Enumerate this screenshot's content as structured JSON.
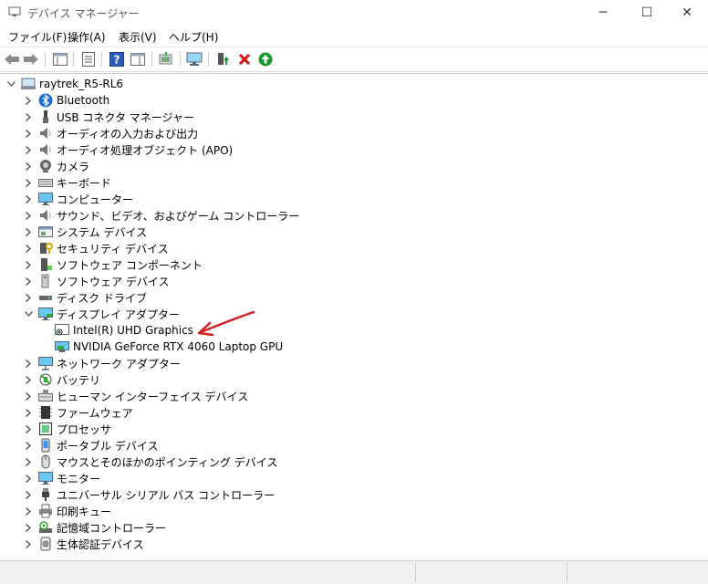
{
  "window": {
    "title": "デバイス マネージャー",
    "minimize_glyph": "─",
    "maximize_glyph": "☐",
    "close_glyph": "✕"
  },
  "menu": [
    "ファイル(F)",
    "操作(A)",
    "表示(V)",
    "ヘルプ(H)"
  ],
  "tree": {
    "root": "raytrek_R5-RL6",
    "categories": [
      {
        "label": "Bluetooth",
        "icon": "bluetooth-icon"
      },
      {
        "label": "USB コネクタ マネージャー",
        "icon": "usb-icon"
      },
      {
        "label": "オーディオの入力および出力",
        "icon": "speaker-icon"
      },
      {
        "label": "オーディオ処理オブジェクト (APO)",
        "icon": "speaker-icon"
      },
      {
        "label": "カメラ",
        "icon": "camera-icon"
      },
      {
        "label": "キーボード",
        "icon": "keyboard-icon"
      },
      {
        "label": "コンピューター",
        "icon": "monitor-icon"
      },
      {
        "label": "サウンド、ビデオ、およびゲーム コントローラー",
        "icon": "speaker-icon"
      },
      {
        "label": "システム デバイス",
        "icon": "system-icon"
      },
      {
        "label": "セキュリティ デバイス",
        "icon": "security-icon"
      },
      {
        "label": "ソフトウェア コンポーネント",
        "icon": "component-icon"
      },
      {
        "label": "ソフトウェア デバイス",
        "icon": "device-icon"
      },
      {
        "label": "ディスク ドライブ",
        "icon": "disk-icon"
      },
      {
        "label": "ディスプレイ アダプター",
        "icon": "display-adapter-icon",
        "expanded": true,
        "children": [
          "Intel(R) UHD Graphics",
          "NVIDIA GeForce RTX 4060 Laptop GPU"
        ]
      },
      {
        "label": "ネットワーク アダプター",
        "icon": "network-icon"
      },
      {
        "label": "バッテリ",
        "icon": "battery-icon"
      },
      {
        "label": "ヒューマン インターフェイス デバイス",
        "icon": "hid-icon"
      },
      {
        "label": "ファームウェア",
        "icon": "firmware-icon"
      },
      {
        "label": "プロセッサ",
        "icon": "processor-icon"
      },
      {
        "label": "ポータブル デバイス",
        "icon": "portable-icon"
      },
      {
        "label": "マウスとそのほかのポインティング デバイス",
        "icon": "mouse-icon"
      },
      {
        "label": "モニター",
        "icon": "monitor-icon"
      },
      {
        "label": "ユニバーサル シリアル バス コントローラー",
        "icon": "usb-plug-icon"
      },
      {
        "label": "印刷キュー",
        "icon": "printer-icon"
      },
      {
        "label": "記憶域コントローラー",
        "icon": "storage-icon"
      },
      {
        "label": "生体認証デバイス",
        "icon": "biometric-icon"
      }
    ]
  },
  "colors": {
    "arrow": "#d42020",
    "accent": "#1e6fd9",
    "remove": "#d01010",
    "update": "#1a9a2a"
  }
}
